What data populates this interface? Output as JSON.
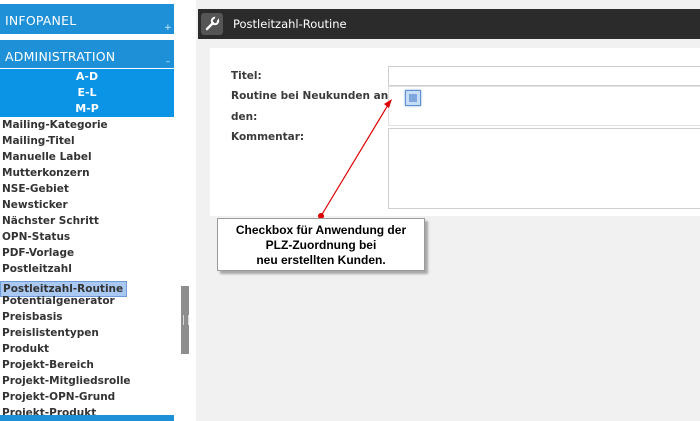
{
  "sidebar": {
    "infopanel_title": "INFOPANEL",
    "administration_title": "ADMINISTRATION",
    "sub_groups": [
      "A-D",
      "E-L",
      "M-P"
    ],
    "items": [
      "Mailing-Kategorie",
      "Mailing-Titel",
      "Manuelle Label",
      "Mutterkonzern",
      "NSE-Gebiet",
      "Newsticker",
      "Nächster Schritt",
      "OPN-Status",
      "PDF-Vorlage",
      "Postleitzahl",
      "Postleitzahl-Routine",
      "Potentialgenerator",
      "Preisbasis",
      "Preislistentypen",
      "Produkt",
      "Projekt-Bereich",
      "Projekt-Mitgliedsrolle",
      "Projekt-OPN-Grund",
      "Projekt-Produkt"
    ],
    "active_item": "Postleitzahl-Routine",
    "colors": {
      "header": "#1e90d8",
      "subgroup": "#0b93e6",
      "active": "#aac9f2"
    }
  },
  "main": {
    "title": "Postleitzahl-Routine",
    "title_icon": "wrench-icon",
    "form": {
      "title_label": "Titel:",
      "routine_label_line1": "Routine bei Neukunden anwen",
      "routine_label_line2": "den:",
      "comment_label": "Kommentar:"
    }
  },
  "annotation": {
    "line1": "Checkbox für Anwendung der",
    "line2": "PLZ-Zuordnung bei",
    "line3": "neu erstellten Kunden.",
    "arrow_color": "#dd0000"
  }
}
